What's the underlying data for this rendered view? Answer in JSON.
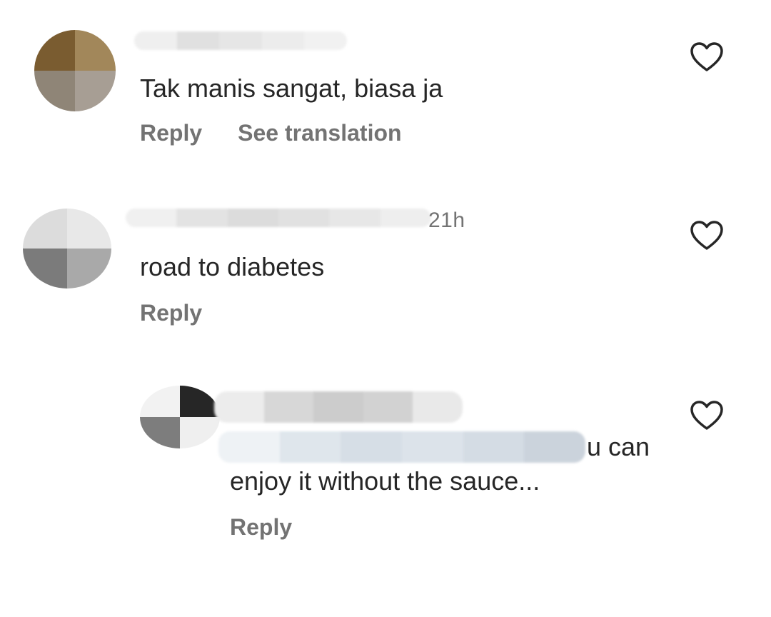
{
  "comments": [
    {
      "username": "",
      "time": "",
      "text": "Tak manis sangat, biasa ja",
      "actions": {
        "reply": "Reply",
        "translate": "See translation"
      },
      "like_icon": "heart-outline-icon",
      "avatar_colors": [
        "#7a5c30",
        "#a2875a",
        "#8f8577",
        "#a79e94"
      ]
    },
    {
      "username": "",
      "time": "21h",
      "text": "road to diabetes",
      "actions": {
        "reply": "Reply"
      },
      "like_icon": "heart-outline-icon",
      "avatar_colors": [
        "#dcdcdc",
        "#e8e8e8",
        "#7b7b7b",
        "#a9a9a9"
      ]
    },
    {
      "username": "",
      "time": "",
      "text_line1_suffix": "u can",
      "text_line2": "enjoy it without the sauce...",
      "actions": {
        "reply": "Reply"
      },
      "like_icon": "heart-outline-icon",
      "avatar_colors": [
        "#f2f2f2",
        "#262626",
        "#7d7d7d",
        "#efefef"
      ]
    }
  ],
  "colors": {
    "text": "#262626",
    "secondary": "#737373",
    "mention": "#00376b",
    "background": "#ffffff"
  }
}
